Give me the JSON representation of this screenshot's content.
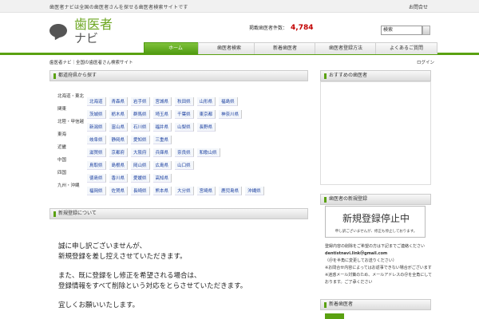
{
  "topbar": {
    "tagline": "歯医者ナビは全国の歯医者さんを探せる歯医者検索サイトです",
    "link": "お問合せ"
  },
  "logo": {
    "line1": "歯医者",
    "line2": "ナビ"
  },
  "counter": {
    "label": "掲載歯医者件数：",
    "value": "4,784"
  },
  "search": {
    "value": "検索"
  },
  "nav": {
    "tabs": [
      {
        "label": "ホーム",
        "active": true
      },
      {
        "label": "歯医者検索"
      },
      {
        "label": "新着歯医者"
      },
      {
        "label": "歯医者登録方法"
      },
      {
        "label": "よくあるご質問"
      }
    ]
  },
  "breadcrumb": "歯医者ナビ｜全国の歯医者さん検索サイト",
  "right_link": "ログイン",
  "main": {
    "region_heading": "都道府県から探す",
    "regions": [
      {
        "name": "北海道・東北",
        "prefs": [
          "北海道",
          "青森県",
          "岩手県",
          "宮城県",
          "秋田県",
          "山形県",
          "福島県"
        ]
      },
      {
        "name": "関東",
        "prefs": [
          "茨城県",
          "栃木県",
          "群馬県",
          "埼玉県",
          "千葉県",
          "東京都",
          "神奈川県"
        ]
      },
      {
        "name": "北陸・甲信越",
        "prefs": [
          "新潟県",
          "富山県",
          "石川県",
          "福井県",
          "山梨県",
          "長野県"
        ]
      },
      {
        "name": "東海",
        "prefs": [
          "岐阜県",
          "静岡県",
          "愛知県",
          "三重県"
        ]
      },
      {
        "name": "近畿",
        "prefs": [
          "滋賀県",
          "京都府",
          "大阪府",
          "兵庫県",
          "奈良県",
          "和歌山県"
        ]
      },
      {
        "name": "中国",
        "prefs": [
          "鳥取県",
          "島根県",
          "岡山県",
          "広島県",
          "山口県"
        ]
      },
      {
        "name": "四国",
        "prefs": [
          "徳島県",
          "香川県",
          "愛媛県",
          "高知県"
        ]
      },
      {
        "name": "九州・沖縄",
        "prefs": [
          "福岡県",
          "佐賀県",
          "長崎県",
          "熊本県",
          "大分県",
          "宮崎県",
          "鹿児島県",
          "沖縄県"
        ]
      }
    ],
    "notice_heading": "新規登録について",
    "notice_paragraphs": [
      "誠に申し訳ございませんが、\n新規登録を差し控えさせていただきます。",
      "また、既に登録をし修正を希望される場合は、\n登録情報をすべて削除という対応をとらさせていただきます。",
      "宜しくお願いいたします。"
    ]
  },
  "sidebar": {
    "heading1": "おすすめの歯医者",
    "heading2": "歯医者の新規登録",
    "stop_big": "新規登録停止中",
    "stop_small": "申し訳ございませんが、修正も停止しております。",
    "contact_line1": "登録内容の削除をご希望の方は下記までご連絡ください",
    "contact_email": "dentistnavi.link＠gmail.com",
    "contact_line2": "（＠を半角に変更してお送りください）",
    "contact_line3": "※お問合せ内容によってはお返事できない場合がございます",
    "contact_line4": "※迷惑メール対策のため、メールアドレスの＠を全角にしております。ご了承ください",
    "heading3": "新着歯医者"
  },
  "colors": {
    "accent": "#5aa111",
    "count": "#c20000",
    "link": "#1a3fa0"
  }
}
